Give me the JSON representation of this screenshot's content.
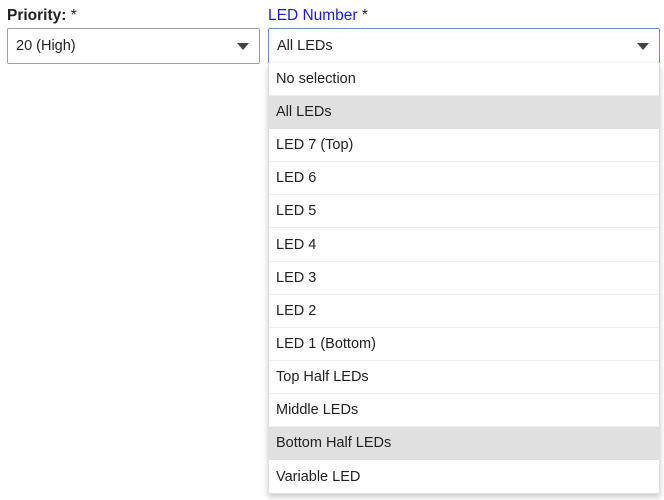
{
  "priority": {
    "label": "Priority:",
    "required_mark": " *",
    "value": "20 (High)"
  },
  "led": {
    "label": "LED Number",
    "required_mark": " *",
    "value": "All LEDs",
    "label_color": "#1a1adc"
  },
  "dropdown": {
    "options": [
      {
        "label": "No selection",
        "highlighted": false
      },
      {
        "label": "All LEDs",
        "highlighted": true
      },
      {
        "label": "LED 7 (Top)",
        "highlighted": false
      },
      {
        "label": "LED 6",
        "highlighted": false
      },
      {
        "label": "LED 5",
        "highlighted": false
      },
      {
        "label": "LED 4",
        "highlighted": false
      },
      {
        "label": "LED 3",
        "highlighted": false
      },
      {
        "label": "LED 2",
        "highlighted": false
      },
      {
        "label": "LED 1 (Bottom)",
        "highlighted": false
      },
      {
        "label": "Top Half LEDs",
        "highlighted": false
      },
      {
        "label": "Middle LEDs",
        "highlighted": false
      },
      {
        "label": "Bottom Half LEDs",
        "highlighted": true
      },
      {
        "label": "Variable LED",
        "highlighted": false
      }
    ]
  },
  "icons": {
    "caret": "chevron-down-icon"
  }
}
